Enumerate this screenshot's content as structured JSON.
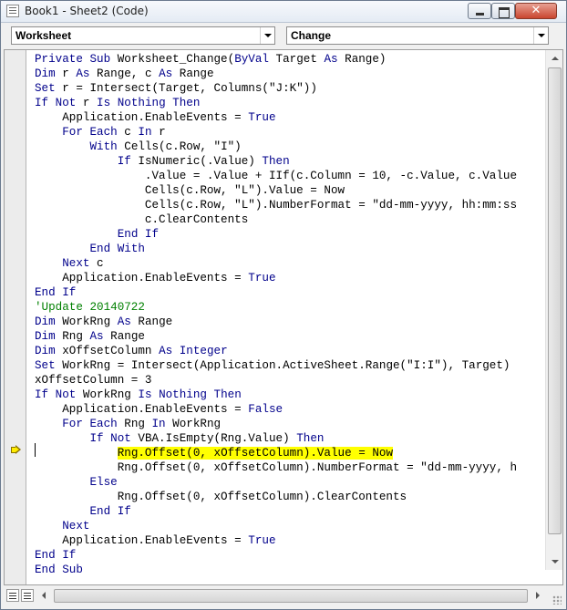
{
  "window": {
    "title": "Book1 - Sheet2 (Code)",
    "close_glyph": "✕"
  },
  "object_dropdown": {
    "value": "Worksheet"
  },
  "procedure_dropdown": {
    "value": "Change"
  },
  "colors": {
    "keyword": "#00008b",
    "comment": "#008000",
    "highlight": "#ffff00"
  },
  "editor": {
    "current_line_marker": "arrow-icon",
    "code_lines": [
      [
        {
          "t": "Private Sub",
          "k": "kw"
        },
        {
          "t": " Worksheet_Change("
        },
        {
          "t": "ByVal",
          "k": "kw"
        },
        {
          "t": " Target "
        },
        {
          "t": "As",
          "k": "kw"
        },
        {
          "t": " Range)"
        }
      ],
      [
        {
          "t": "Dim",
          "k": "kw"
        },
        {
          "t": " r "
        },
        {
          "t": "As",
          "k": "kw"
        },
        {
          "t": " Range, c "
        },
        {
          "t": "As",
          "k": "kw"
        },
        {
          "t": " Range"
        }
      ],
      [
        {
          "t": "Set",
          "k": "kw"
        },
        {
          "t": " r = Intersect(Target, Columns(\"J:K\"))"
        }
      ],
      [
        {
          "t": "If Not",
          "k": "kw"
        },
        {
          "t": " r "
        },
        {
          "t": "Is Nothing Then",
          "k": "kw"
        }
      ],
      [
        {
          "t": "    Application.EnableEvents = "
        },
        {
          "t": "True",
          "k": "kw"
        }
      ],
      [
        {
          "t": "    "
        },
        {
          "t": "For Each",
          "k": "kw"
        },
        {
          "t": " c "
        },
        {
          "t": "In",
          "k": "kw"
        },
        {
          "t": " r"
        }
      ],
      [
        {
          "t": "        "
        },
        {
          "t": "With",
          "k": "kw"
        },
        {
          "t": " Cells(c.Row, \"I\")"
        }
      ],
      [
        {
          "t": "            "
        },
        {
          "t": "If",
          "k": "kw"
        },
        {
          "t": " IsNumeric(.Value) "
        },
        {
          "t": "Then",
          "k": "kw"
        }
      ],
      [
        {
          "t": "                .Value = .Value + IIf(c.Column = 10, -c.Value, c.Value"
        }
      ],
      [
        {
          "t": "                Cells(c.Row, \"L\").Value = Now"
        }
      ],
      [
        {
          "t": "                Cells(c.Row, \"L\").NumberFormat = \"dd-mm-yyyy, hh:mm:ss"
        }
      ],
      [
        {
          "t": "                c.ClearContents"
        }
      ],
      [
        {
          "t": "            "
        },
        {
          "t": "End If",
          "k": "kw"
        }
      ],
      [
        {
          "t": "        "
        },
        {
          "t": "End With",
          "k": "kw"
        }
      ],
      [
        {
          "t": "    "
        },
        {
          "t": "Next",
          "k": "kw"
        },
        {
          "t": " c"
        }
      ],
      [
        {
          "t": "    Application.EnableEvents = "
        },
        {
          "t": "True",
          "k": "kw"
        }
      ],
      [
        {
          "t": "End If",
          "k": "kw"
        }
      ],
      [
        {
          "t": "'Update 20140722",
          "k": "cm"
        }
      ],
      [
        {
          "t": "Dim",
          "k": "kw"
        },
        {
          "t": " WorkRng "
        },
        {
          "t": "As",
          "k": "kw"
        },
        {
          "t": " Range"
        }
      ],
      [
        {
          "t": "Dim",
          "k": "kw"
        },
        {
          "t": " Rng "
        },
        {
          "t": "As",
          "k": "kw"
        },
        {
          "t": " Range"
        }
      ],
      [
        {
          "t": "Dim",
          "k": "kw"
        },
        {
          "t": " xOffsetColumn "
        },
        {
          "t": "As Integer",
          "k": "kw"
        }
      ],
      [
        {
          "t": "Set",
          "k": "kw"
        },
        {
          "t": " WorkRng = Intersect(Application.ActiveSheet.Range(\"I:I\"), Target)"
        }
      ],
      [
        {
          "t": "xOffsetColumn = 3"
        }
      ],
      [
        {
          "t": "If Not",
          "k": "kw"
        },
        {
          "t": " WorkRng "
        },
        {
          "t": "Is Nothing Then",
          "k": "kw"
        }
      ],
      [
        {
          "t": "    Application.EnableEvents = "
        },
        {
          "t": "False",
          "k": "kw"
        }
      ],
      [
        {
          "t": "    "
        },
        {
          "t": "For Each",
          "k": "kw"
        },
        {
          "t": " Rng "
        },
        {
          "t": "In",
          "k": "kw"
        },
        {
          "t": " WorkRng"
        }
      ],
      [
        {
          "t": "        "
        },
        {
          "t": "If Not",
          "k": "kw"
        },
        {
          "t": " VBA.IsEmpty(Rng.Value) "
        },
        {
          "t": "Then",
          "k": "kw"
        }
      ],
      [
        {
          "t": "            "
        },
        {
          "t": "Rng.Offset(0, xOffsetColumn).Value = Now",
          "k": "hl"
        }
      ],
      [
        {
          "t": "            Rng.Offset(0, xOffsetColumn).NumberFormat = \"dd-mm-yyyy, h"
        }
      ],
      [
        {
          "t": "        "
        },
        {
          "t": "Else",
          "k": "kw"
        }
      ],
      [
        {
          "t": "            Rng.Offset(0, xOffsetColumn).ClearContents"
        }
      ],
      [
        {
          "t": "        "
        },
        {
          "t": "End If",
          "k": "kw"
        }
      ],
      [
        {
          "t": "    "
        },
        {
          "t": "Next",
          "k": "kw"
        }
      ],
      [
        {
          "t": "    Application.EnableEvents = "
        },
        {
          "t": "True",
          "k": "kw"
        }
      ],
      [
        {
          "t": "End If",
          "k": "kw"
        }
      ],
      [
        {
          "t": "End Sub",
          "k": "kw"
        }
      ]
    ]
  }
}
